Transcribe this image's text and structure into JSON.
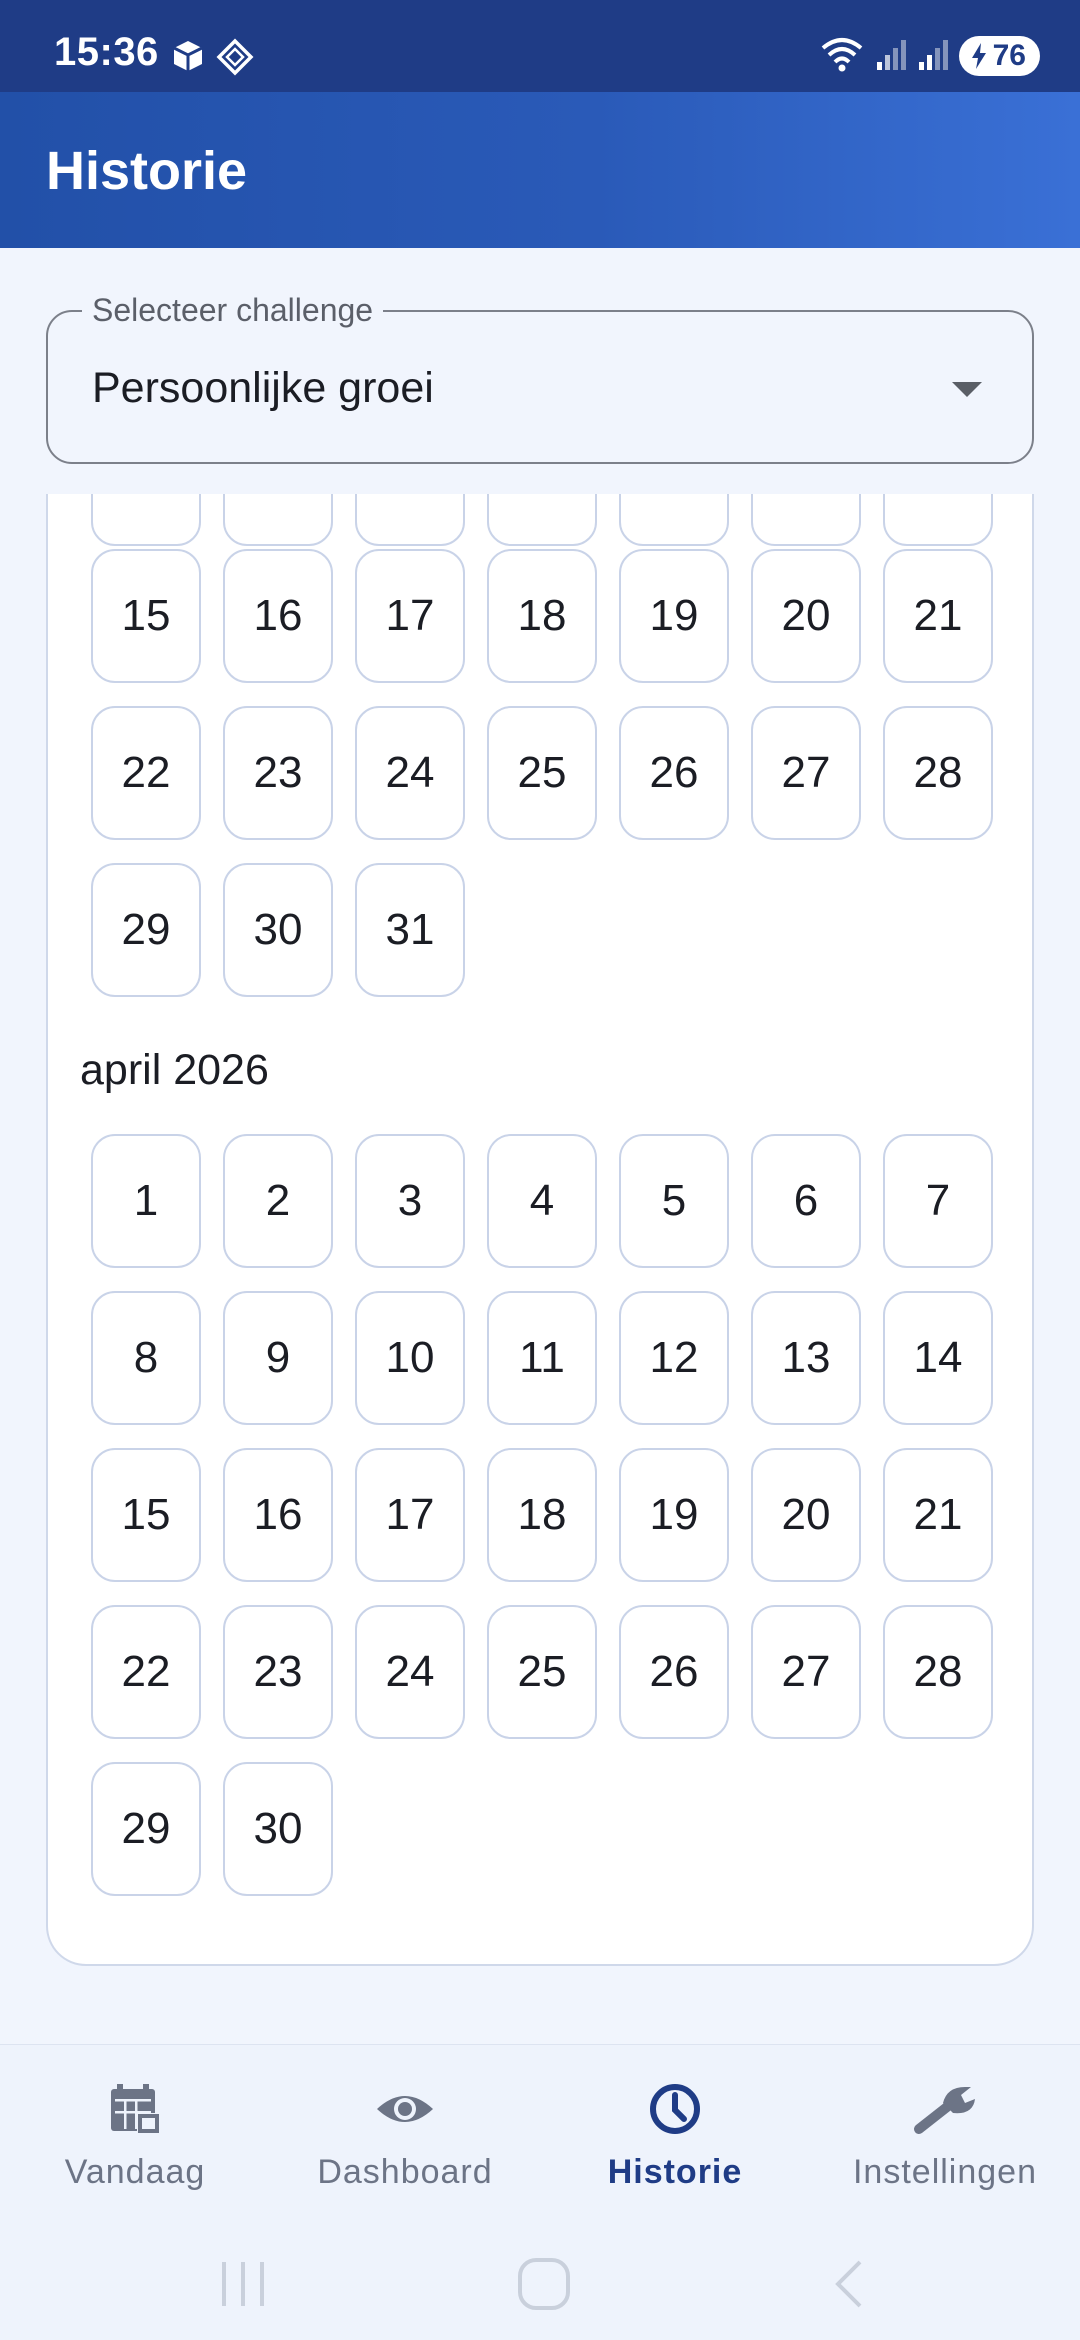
{
  "status_bar": {
    "time": "15:36",
    "battery": "76",
    "icons": [
      "cube-icon",
      "diamond-icon",
      "wifi-icon",
      "signal-icon",
      "signal-icon",
      "battery-icon"
    ]
  },
  "app_bar": {
    "title": "Historie"
  },
  "challenge_select": {
    "label": "Selecteer challenge",
    "value": "Persoonlijke groei"
  },
  "calendar": {
    "partial_month": {
      "rows": [
        [
          "15",
          "16",
          "17",
          "18",
          "19",
          "20",
          "21"
        ],
        [
          "22",
          "23",
          "24",
          "25",
          "26",
          "27",
          "28"
        ],
        [
          "29",
          "30",
          "31"
        ]
      ]
    },
    "april": {
      "label": "april 2026",
      "rows": [
        [
          "1",
          "2",
          "3",
          "4",
          "5",
          "6",
          "7"
        ],
        [
          "8",
          "9",
          "10",
          "11",
          "12",
          "13",
          "14"
        ],
        [
          "15",
          "16",
          "17",
          "18",
          "19",
          "20",
          "21"
        ],
        [
          "22",
          "23",
          "24",
          "25",
          "26",
          "27",
          "28"
        ],
        [
          "29",
          "30"
        ]
      ]
    }
  },
  "bottom_nav": {
    "items": [
      {
        "label": "Vandaag",
        "icon": "calendar-icon"
      },
      {
        "label": "Dashboard",
        "icon": "eye-icon"
      },
      {
        "label": "Historie",
        "icon": "clock-icon"
      },
      {
        "label": "Instellingen",
        "icon": "wrench-icon"
      }
    ],
    "active": "Historie"
  },
  "colors": {
    "primary": "#1f3c86",
    "appbar_end": "#3a70d6",
    "background": "#f1f5fd",
    "day_border": "#c9d3e8"
  }
}
